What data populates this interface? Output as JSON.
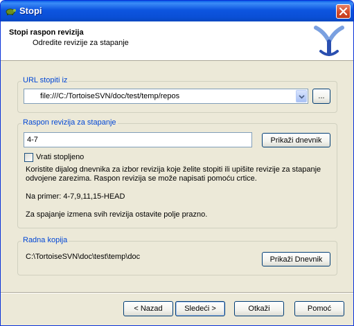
{
  "window": {
    "title": "Stopi"
  },
  "header": {
    "title": "Stopi raspon revizija",
    "subtitle": "Odredite revizije za stapanje"
  },
  "url_group": {
    "label": "URL stopiti iz",
    "value": "file:///C:/TortoiseSVN/doc/test/temp/repos",
    "browse_label": "..."
  },
  "range_group": {
    "label": "Raspon revizija za stapanje",
    "value": "4-7",
    "show_log_label": "Prikaži dnevnik",
    "revert_label": "Vrati stopljeno",
    "help_line1": "Koristite dijalog dnevnika za izbor revizija koje želite stopiti ili upišite revizije za stapanje",
    "help_line2": "odvojene zarezima. Raspon revizija se može napisati pomoću crtice.",
    "example": "Na primer: 4-7,9,11,15-HEAD",
    "empty_hint": "Za spajanje izmena svih revizija ostavite polje prazno."
  },
  "wc_group": {
    "label": "Radna kopija",
    "path": "C:\\TortoiseSVN\\doc\\test\\temp\\doc",
    "show_log_label": "Prikaži Dnevnik"
  },
  "footer": {
    "back_label": "< Nazad",
    "next_label": "Sledeći >",
    "cancel_label": "Otkaži",
    "help_label": "Pomoć"
  }
}
